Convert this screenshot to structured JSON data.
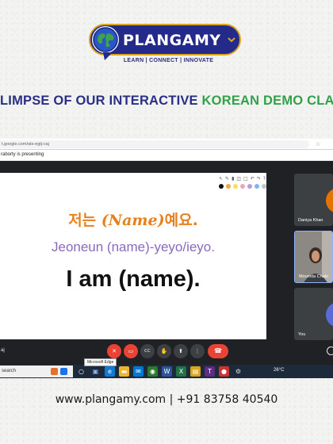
{
  "brand": {
    "name": "PLANGAMY",
    "tagline": "LEARN | CONNECT | INNOVATE",
    "colors": {
      "navy": "#232a8a",
      "gold": "#d9a51c",
      "green": "#2fa24a"
    }
  },
  "headline": {
    "part1": "LIMPSE OF OUR INTERACTIVE ",
    "part2": "KOREAN DEMO CLA"
  },
  "browser": {
    "url": "t.google.com/ats-egtj-caj"
  },
  "meet": {
    "presenting_banner": "raborty is presenting",
    "slide": {
      "korean_a": "저는 ",
      "korean_name": "(Name)",
      "korean_b": "예요.",
      "romanization": "Jeoneun (name)-yeyo/ieyo.",
      "english": "I am (name)."
    },
    "participants": [
      {
        "name": "Daniya Khan",
        "avatar_color": "#e37400"
      },
      {
        "name": "Moumita Chakr",
        "video": true
      },
      {
        "name": "You",
        "avatar_color": "#5b6bd5"
      }
    ],
    "bottom_name": "aj",
    "controls": [
      {
        "name": "mic-off",
        "icon": "mic-off-icon",
        "glyph": "✕",
        "color": "red"
      },
      {
        "name": "camera-off",
        "icon": "camera-off-icon",
        "glyph": "▭",
        "color": "red"
      },
      {
        "name": "captions",
        "icon": "captions-icon",
        "glyph": "CC",
        "color": "grey"
      },
      {
        "name": "raise-hand",
        "icon": "hand-icon",
        "glyph": "✋",
        "color": "grey"
      },
      {
        "name": "present",
        "icon": "present-icon",
        "glyph": "⬆",
        "color": "grey"
      },
      {
        "name": "more",
        "icon": "more-icon",
        "glyph": "⋮",
        "color": "grey"
      }
    ],
    "end_call_glyph": "☎"
  },
  "taskbar": {
    "search_text": "search",
    "tooltip": "Microsoft Edge",
    "temperature": "26°C"
  },
  "footer": {
    "text": "www.plangamy.com | +91 83758 40540"
  }
}
